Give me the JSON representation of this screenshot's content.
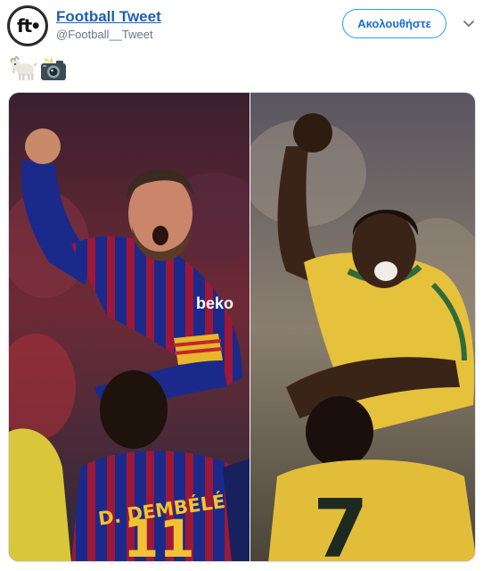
{
  "account": {
    "display_name": "Football Tweet",
    "handle": "@Football__Tweet",
    "avatar_text": "ft"
  },
  "follow_button": {
    "label": "Ακολουθήστε"
  },
  "tweet": {
    "emojis": [
      "goat-emoji",
      "camera-flash-emoji"
    ]
  },
  "media": {
    "left_photo": {
      "shirt_sponsor": "beko",
      "back_name": "D. DEMBÉLÉ",
      "back_number": "11"
    },
    "right_photo": {
      "back_number": "7"
    }
  },
  "colors": {
    "link_blue": "#1b5fb4",
    "follow_border": "#1da1f2",
    "barca_blue": "#1b2a8a",
    "barca_red": "#9c1838",
    "brazil_yellow": "#e6c13b",
    "brazil_green": "#2f6b3a"
  }
}
